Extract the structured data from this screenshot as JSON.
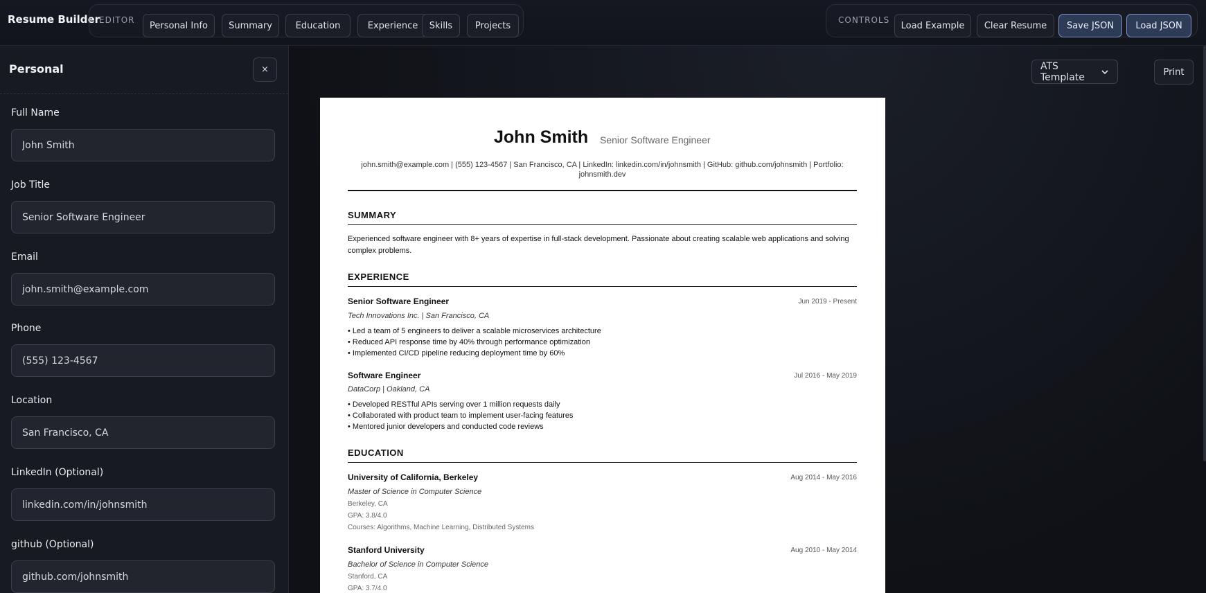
{
  "app": {
    "brand": "Resume Builder"
  },
  "editor_nav": {
    "label": "EDITOR",
    "items": [
      "Personal Info",
      "Summary",
      "Education",
      "Experience",
      "Skills",
      "Projects"
    ]
  },
  "controls": {
    "label": "CONTROLS",
    "load_example": "Load Example",
    "clear_resume": "Clear Resume",
    "save_json": "Save JSON",
    "load_json": "Load JSON"
  },
  "sidebar": {
    "title": "Personal",
    "close": "×",
    "fields": [
      {
        "label": "Full Name",
        "value": "John Smith"
      },
      {
        "label": "Job Title",
        "value": "Senior Software Engineer"
      },
      {
        "label": "Email",
        "value": "john.smith@example.com"
      },
      {
        "label": "Phone",
        "value": "(555) 123-4567"
      },
      {
        "label": "Location",
        "value": "San Francisco, CA"
      },
      {
        "label": "LinkedIn (Optional)",
        "value": "linkedin.com/in/johnsmith"
      },
      {
        "label": "github (Optional)",
        "value": "github.com/johnsmith"
      }
    ]
  },
  "toolbar": {
    "template": "ATS Template",
    "print": "Print"
  },
  "resume": {
    "name": "John Smith",
    "title": "Senior Software Engineer",
    "contact": "john.smith@example.com | (555) 123-4567 | San Francisco, CA | LinkedIn: linkedin.com/in/johnsmith | GitHub: github.com/johnsmith | Portfolio: johnsmith.dev",
    "summary_heading": "SUMMARY",
    "summary": "Experienced software engineer with 8+ years of expertise in full-stack development. Passionate about creating scalable web applications and solving complex problems.",
    "experience_heading": "EXPERIENCE",
    "experience": [
      {
        "role": "Senior Software Engineer",
        "dates": "Jun 2019 - Present",
        "company": "Tech Innovations Inc. | San Francisco, CA",
        "bullets": [
          "• Led a team of 5 engineers to deliver a scalable microservices architecture",
          "• Reduced API response time by 40% through performance optimization",
          "• Implemented CI/CD pipeline reducing deployment time by 60%"
        ]
      },
      {
        "role": "Software Engineer",
        "dates": "Jul 2016 - May 2019",
        "company": "DataCorp | Oakland, CA",
        "bullets": [
          "• Developed RESTful APIs serving over 1 million requests daily",
          "• Collaborated with product team to implement user-facing features",
          "• Mentored junior developers and conducted code reviews"
        ]
      }
    ],
    "education_heading": "EDUCATION",
    "education": [
      {
        "school": "University of California, Berkeley",
        "dates": "Aug 2014 - May 2016",
        "degree": "Master of Science in Computer Science",
        "location": "Berkeley, CA",
        "gpa": "GPA: 3.8/4.0",
        "courses": "Courses: Algorithms, Machine Learning, Distributed Systems"
      },
      {
        "school": "Stanford University",
        "dates": "Aug 2010 - May 2014",
        "degree": "Bachelor of Science in Computer Science",
        "location": "Stanford, CA",
        "gpa": "GPA: 3.7/4.0"
      }
    ]
  }
}
